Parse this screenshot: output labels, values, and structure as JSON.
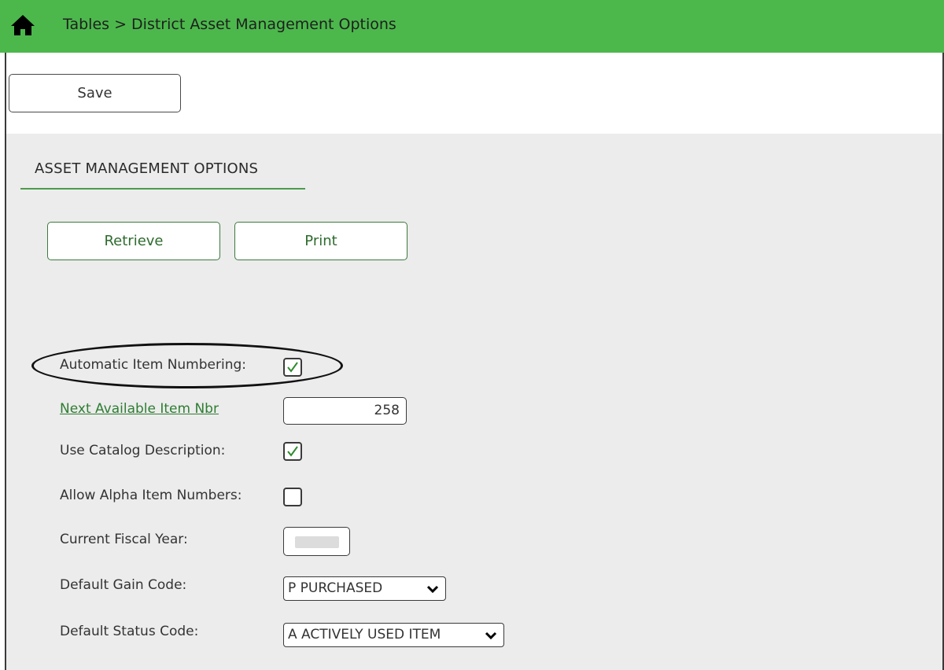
{
  "header": {
    "breadcrumb": "Tables > District Asset Management Options",
    "home_icon": "home-icon",
    "bg_color": "#4cb84c"
  },
  "toolbar": {
    "save_label": "Save"
  },
  "section": {
    "title": "ASSET MANAGEMENT OPTIONS",
    "retrieve_label": "Retrieve",
    "print_label": "Print"
  },
  "fields": {
    "auto_numbering": {
      "label": "Automatic Item Numbering:",
      "checked": true
    },
    "next_item_nbr": {
      "label": "Next Available Item Nbr",
      "value": "258"
    },
    "use_catalog": {
      "label": "Use Catalog Description:",
      "checked": true
    },
    "allow_alpha": {
      "label": "Allow Alpha Item Numbers:",
      "checked": false
    },
    "fiscal_year": {
      "label": "Current Fiscal Year:"
    },
    "gain_code": {
      "label": "Default Gain Code:",
      "value": "P PURCHASED"
    },
    "status_code": {
      "label": "Default Status Code:",
      "value": "A ACTIVELY USED ITEM"
    }
  }
}
